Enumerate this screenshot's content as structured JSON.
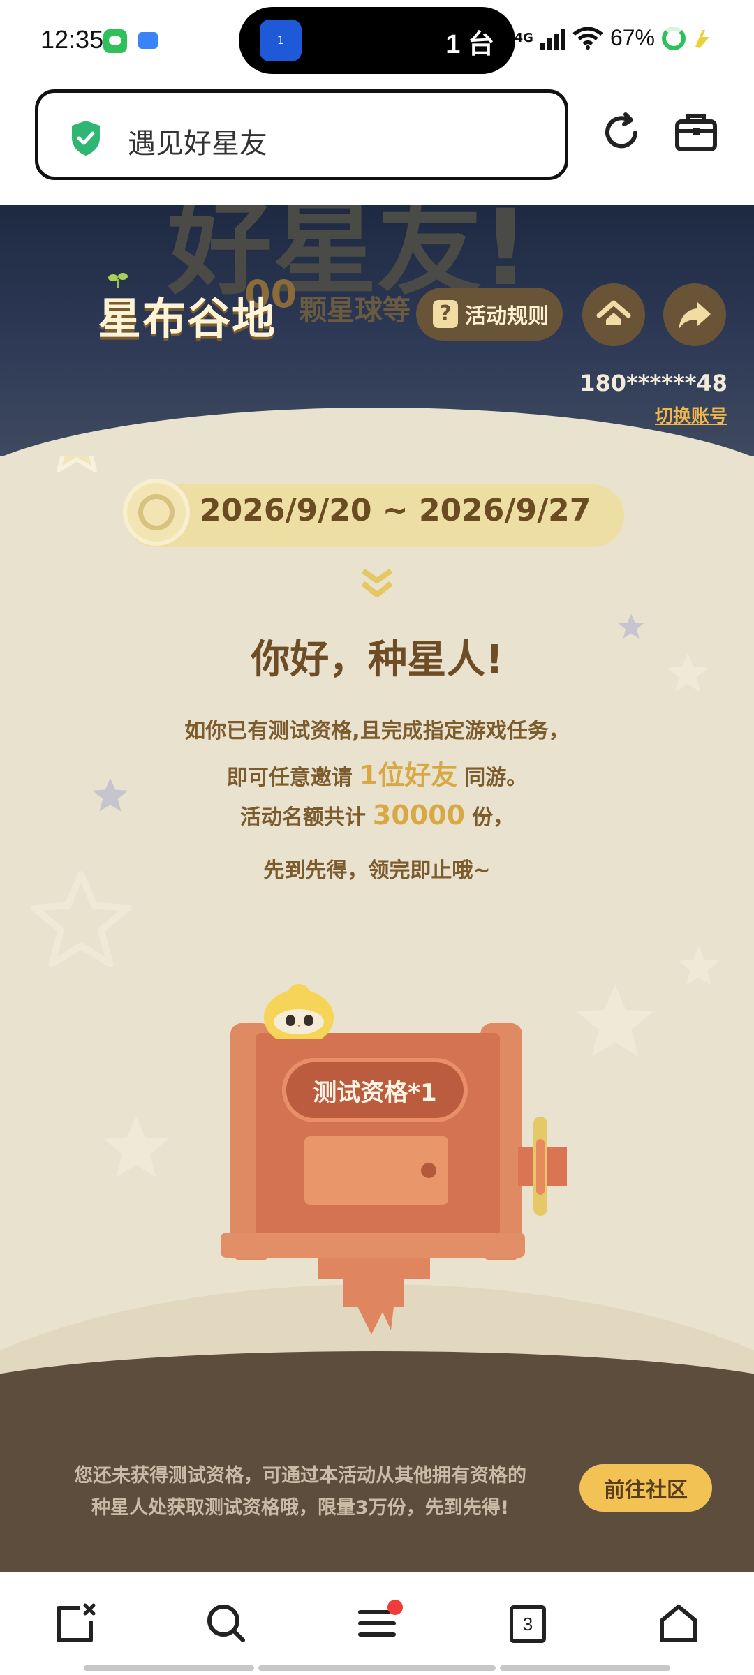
{
  "status_bar": {
    "time": "12:35",
    "island_badge": "1",
    "island_text": "1 台",
    "network": "4G",
    "battery": "67%"
  },
  "address_bar": {
    "title": "遇见好星友",
    "icons": [
      "shield-check-icon",
      "reload-icon",
      "toolbox-icon"
    ]
  },
  "banner": {
    "bg_title": "好星友!",
    "bg_subtitle": "颗星球等",
    "bg_number": "00",
    "logo": "星布谷地",
    "rules_button": "活动规则",
    "rules_icon": "?",
    "account": "180******48",
    "switch_account": "切换账号"
  },
  "event": {
    "date_range": "2026/9/20 ~ 2026/9/27",
    "greeting": "你好，种星人!",
    "line1": "如你已有测试资格,且完成指定游戏任务，",
    "line2_pre": "即可任意邀请",
    "line2_hl": "1位好友",
    "line2_post": "同游。",
    "line3_pre": "活动名额共计",
    "line3_hl": "30000",
    "line3_post": "份，",
    "line4": "先到先得，领完即止哦~",
    "machine_label": "测试资格*1"
  },
  "footer": {
    "notice_line1": "您还未获得测试资格，可通过本活动从其他拥有资格的",
    "notice_line2": "种星人处获取测试资格哦，限量3万份，先到先得!",
    "cta": "前往社区"
  },
  "bottom_nav": {
    "tab_count": "3",
    "items": [
      "close-tab-icon",
      "search-icon",
      "menu-icon",
      "tabs-icon",
      "home-icon"
    ]
  },
  "colors": {
    "accent": "#d8a844",
    "cta": "#f2c354",
    "background": "#e8e2cf",
    "dark_strip": "#5c4d3c"
  }
}
